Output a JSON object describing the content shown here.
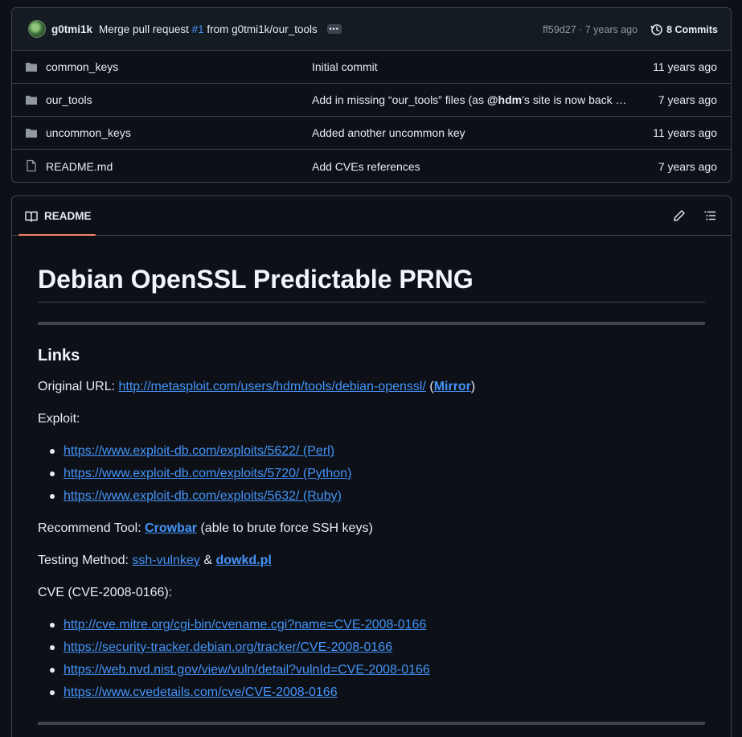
{
  "commit": {
    "author": "g0tmi1k",
    "message_prefix": "Merge pull request",
    "pr_number": "#1",
    "message_suffix": "from g0tmi1k/our_tools",
    "sha_age": "ff59d27 · 7 years ago",
    "commits_label": "8 Commits"
  },
  "files": [
    {
      "name": "common_keys",
      "type": "folder",
      "message": "Initial commit",
      "age": "11 years ago"
    },
    {
      "name": "our_tools",
      "type": "folder",
      "message_pre": "Add in missing “our_tools” files (as ",
      "message_bold": "@hdm",
      "message_post": "’s site is now back …",
      "age": "7 years ago"
    },
    {
      "name": "uncommon_keys",
      "type": "folder",
      "message": "Added another uncommon key",
      "age": "11 years ago"
    },
    {
      "name": "README.md",
      "type": "file",
      "message": "Add CVEs references",
      "age": "7 years ago"
    }
  ],
  "readme": {
    "tab_label": "README",
    "title": "Debian OpenSSL Predictable PRNG",
    "links_heading": "Links",
    "original_url_label": "Original URL: ",
    "original_url": "http://metasploit.com/users/hdm/tools/debian-openssl/",
    "open_paren": " (",
    "mirror_label": "Mirror",
    "close_paren": ")",
    "exploit_label": "Exploit:",
    "exploits": [
      "https://www.exploit-db.com/exploits/5622/ (Perl)",
      "https://www.exploit-db.com/exploits/5720/ (Python)",
      "https://www.exploit-db.com/exploits/5632/ (Ruby)"
    ],
    "recommend_label": "Recommend Tool: ",
    "crowbar_label": "Crowbar",
    "recommend_suffix": " (able to brute force SSH keys)",
    "testing_label": "Testing Method: ",
    "ssh_vulnkey": "ssh-vulnkey",
    "amp": " & ",
    "dowkd": "dowkd.pl",
    "cve_label": "CVE (CVE-2008-0166):",
    "cves": [
      "http://cve.mitre.org/cgi-bin/cvename.cgi?name=CVE-2008-0166",
      "https://security-tracker.debian.org/tracker/CVE-2008-0166",
      "https://web.nvd.nist.gov/view/vuln/detail?vulnId=CVE-2008-0166",
      "https://www.cvedetails.com/cve/CVE-2008-0166"
    ]
  },
  "colors": {
    "background": "#0d1117",
    "border": "#3d444d",
    "link": "#4493f8",
    "tab_underline": "#f78166"
  }
}
